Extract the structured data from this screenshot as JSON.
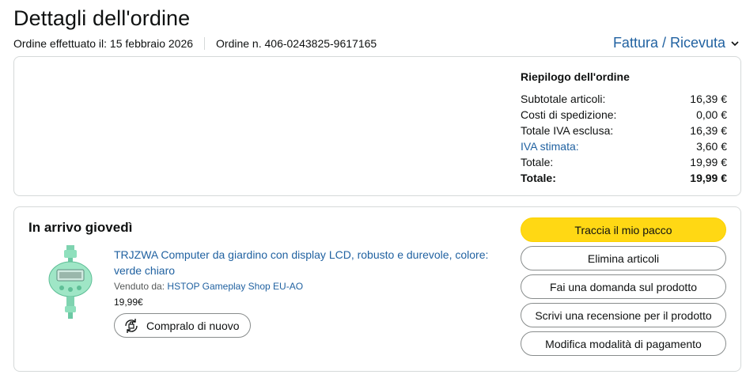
{
  "header": {
    "title": "Dettagli dell'ordine",
    "order_date": "Ordine effettuato il: 15 febbraio 2026",
    "order_number": "Ordine n. 406-0243825-9617165",
    "invoice_label": "Fattura / Ricevuta"
  },
  "summary": {
    "title": "Riepilogo dell'ordine",
    "rows": [
      {
        "label": "Subtotale articoli:",
        "value": "16,39 €"
      },
      {
        "label": "Costi di spedizione:",
        "value": "0,00 €"
      },
      {
        "label": "Totale IVA esclusa:",
        "value": "16,39 €"
      },
      {
        "label": "IVA stimata:",
        "value": "3,60 €"
      },
      {
        "label": "Totale:",
        "value": "19,99 €"
      },
      {
        "label": "Totale:",
        "value": "19,99 €"
      }
    ]
  },
  "arrival": {
    "title": "In arrivo giovedì",
    "product": {
      "name": "TRJZWA Computer da giardino con display LCD, robusto e durevole, colore: verde chiaro",
      "sold_by_label": "Venduto da:",
      "seller": "HSTOP Gameplay Shop EU-AO",
      "price": "19,99€",
      "buy_again": "Compralo di nuovo",
      "image_icon": "garden-timer-image"
    },
    "actions": {
      "track": "Traccia il mio pacco",
      "remove": "Elimina articoli",
      "ask": "Fai una domanda sul prodotto",
      "review": "Scrivi una recensione per il prodotto",
      "payment": "Modifica modalità di pagamento"
    }
  },
  "colors": {
    "link": "#2162a1",
    "primary_button": "#ffd814",
    "border": "#d5d9d9"
  }
}
